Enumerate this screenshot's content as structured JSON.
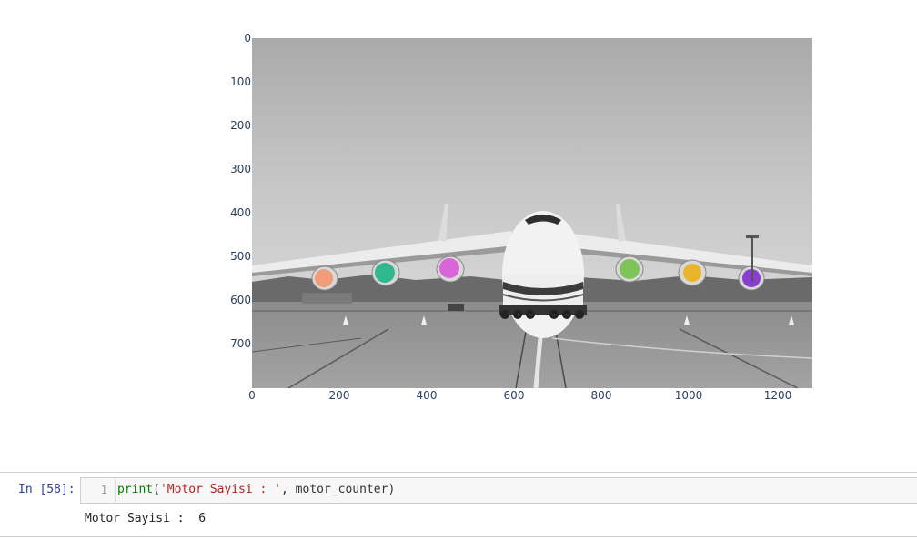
{
  "plot": {
    "y_ticks": [
      "0",
      "100",
      "200",
      "300",
      "400",
      "500",
      "600",
      "700"
    ],
    "x_ticks": [
      "0",
      "200",
      "400",
      "600",
      "800",
      "1000",
      "1200"
    ],
    "engine_marker_colors": [
      "#f29c7a",
      "#2fb88e",
      "#d866d8",
      "#7fc45a",
      "#e8b52a",
      "#8a3ed0"
    ]
  },
  "cell": {
    "prompt": "In [58]:",
    "line_number": "1",
    "code": {
      "func": "print",
      "open": "(",
      "string": "'Motor Sayisi : '",
      "rest": ", motor_counter",
      "close": ")"
    },
    "output": "Motor Sayisi :  6"
  }
}
